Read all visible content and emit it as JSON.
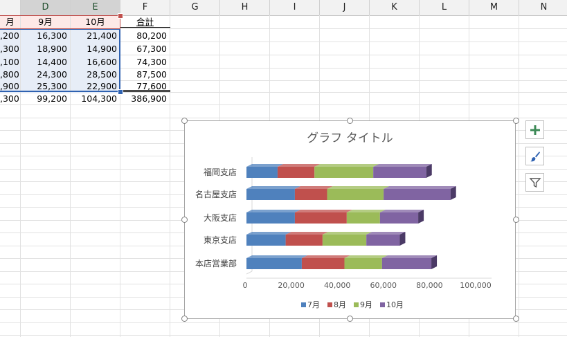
{
  "columns": [
    "",
    "D",
    "E",
    "F",
    "G",
    "H",
    "I",
    "J",
    "K",
    "L",
    "M",
    "N"
  ],
  "header_row": {
    "partial": "月",
    "d": "9月",
    "e": "10月",
    "f": "合計"
  },
  "rows": [
    {
      "partial": ",200",
      "d": "16,300",
      "e": "21,400",
      "f": "80,200"
    },
    {
      "partial": ",300",
      "d": "18,900",
      "e": "14,900",
      "f": "67,300"
    },
    {
      "partial": ",100",
      "d": "14,400",
      "e": "16,600",
      "f": "74,300"
    },
    {
      "partial": ",800",
      "d": "24,300",
      "e": "28,500",
      "f": "87,500"
    },
    {
      "partial": ",900",
      "d": "25,300",
      "e": "22,900",
      "f": "77,600"
    }
  ],
  "total_row": {
    "partial": ",300",
    "d": "99,200",
    "e": "104,300",
    "f": "386,900"
  },
  "chart": {
    "title": "グラフ タイトル",
    "side_buttons": [
      "plus-icon",
      "brush-icon",
      "filter-icon"
    ]
  },
  "chart_data": {
    "type": "bar",
    "orientation": "horizontal-stacked-3d",
    "categories": [
      "福岡支店",
      "名古屋支店",
      "大阪支店",
      "東京支店",
      "本店営業部"
    ],
    "series": [
      {
        "name": "7月",
        "color": "#4f81bd",
        "values": [
          13500,
          21000,
          21000,
          17000,
          24000
        ]
      },
      {
        "name": "8月",
        "color": "#c0504d",
        "values": [
          16000,
          14000,
          22500,
          16000,
          18500
        ]
      },
      {
        "name": "9月",
        "color": "#9bbb59",
        "values": [
          25500,
          24500,
          14400,
          19000,
          16300
        ]
      },
      {
        "name": "10月",
        "color": "#8064a2",
        "values": [
          23000,
          29000,
          16600,
          14500,
          21400
        ]
      }
    ],
    "xticks": [
      "0",
      "20,000",
      "40,000",
      "60,000",
      "80,000",
      "100,000"
    ],
    "xlim": [
      0,
      100000
    ],
    "legend": "bottom"
  }
}
